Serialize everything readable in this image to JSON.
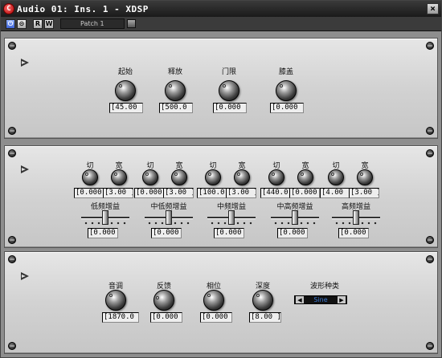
{
  "window": {
    "title": "Audio 01: Ins. 1 - XDSP",
    "close_label": "×"
  },
  "toolbar": {
    "buttons": [
      {
        "icon": "power-icon",
        "label": "⏻"
      },
      {
        "icon": "bypass-icon",
        "label": "⊝"
      },
      {
        "icon": "read-icon",
        "label": "R"
      },
      {
        "icon": "write-icon",
        "label": "W"
      }
    ],
    "patch_name": "Patch 1"
  },
  "panel1": {
    "controls": [
      {
        "label": "起始",
        "value": "[45.00 ]"
      },
      {
        "label": "释放",
        "value": "[500.0 ]"
      },
      {
        "label": "门限",
        "value": "[0.000 ]"
      },
      {
        "label": "膝盖",
        "value": "[0.000 ]"
      }
    ]
  },
  "panel2": {
    "bands": [
      {
        "knobs": [
          {
            "label": "切",
            "value": "[0.000 ]"
          },
          {
            "label": "宽",
            "value": "[3.00 ]"
          }
        ]
      },
      {
        "knobs": [
          {
            "label": "切",
            "value": "[0.000 ]"
          },
          {
            "label": "宽",
            "value": "[3.00 ]"
          }
        ]
      },
      {
        "knobs": [
          {
            "label": "切",
            "value": "[100.0 ]"
          },
          {
            "label": "宽",
            "value": "[3.00 ]"
          }
        ]
      },
      {
        "knobs": [
          {
            "label": "切",
            "value": "[440.0 ]"
          },
          {
            "label": "宽",
            "value": "[0.000 ]"
          }
        ]
      },
      {
        "knobs": [
          {
            "label": "切",
            "value": "[4.00 ]"
          },
          {
            "label": "宽",
            "value": "[3.00 ]"
          }
        ]
      }
    ],
    "gains": [
      {
        "label": "低频增益",
        "value": "[0.000 ]",
        "level": 0.5
      },
      {
        "label": "中低频增益",
        "value": "[0.000 ]",
        "level": 0.5
      },
      {
        "label": "中频增益",
        "value": "[0.000 ]",
        "level": 0.5
      },
      {
        "label": "中高频增益",
        "value": "[0.000 ]",
        "level": 0.5
      },
      {
        "label": "高频增益",
        "value": "[0.000 ]",
        "level": 0.5
      }
    ]
  },
  "panel3": {
    "controls": [
      {
        "label": "音调",
        "value": "[1870.0 ]"
      },
      {
        "label": "反馈",
        "value": "[0.000 ]"
      },
      {
        "label": "相位",
        "value": "[0.000 ]"
      },
      {
        "label": "深度",
        "value": "[8.00 ]"
      }
    ],
    "waveform": {
      "label": "波形种类",
      "value": "Sine",
      "prev": "◀",
      "next": "▶"
    }
  }
}
